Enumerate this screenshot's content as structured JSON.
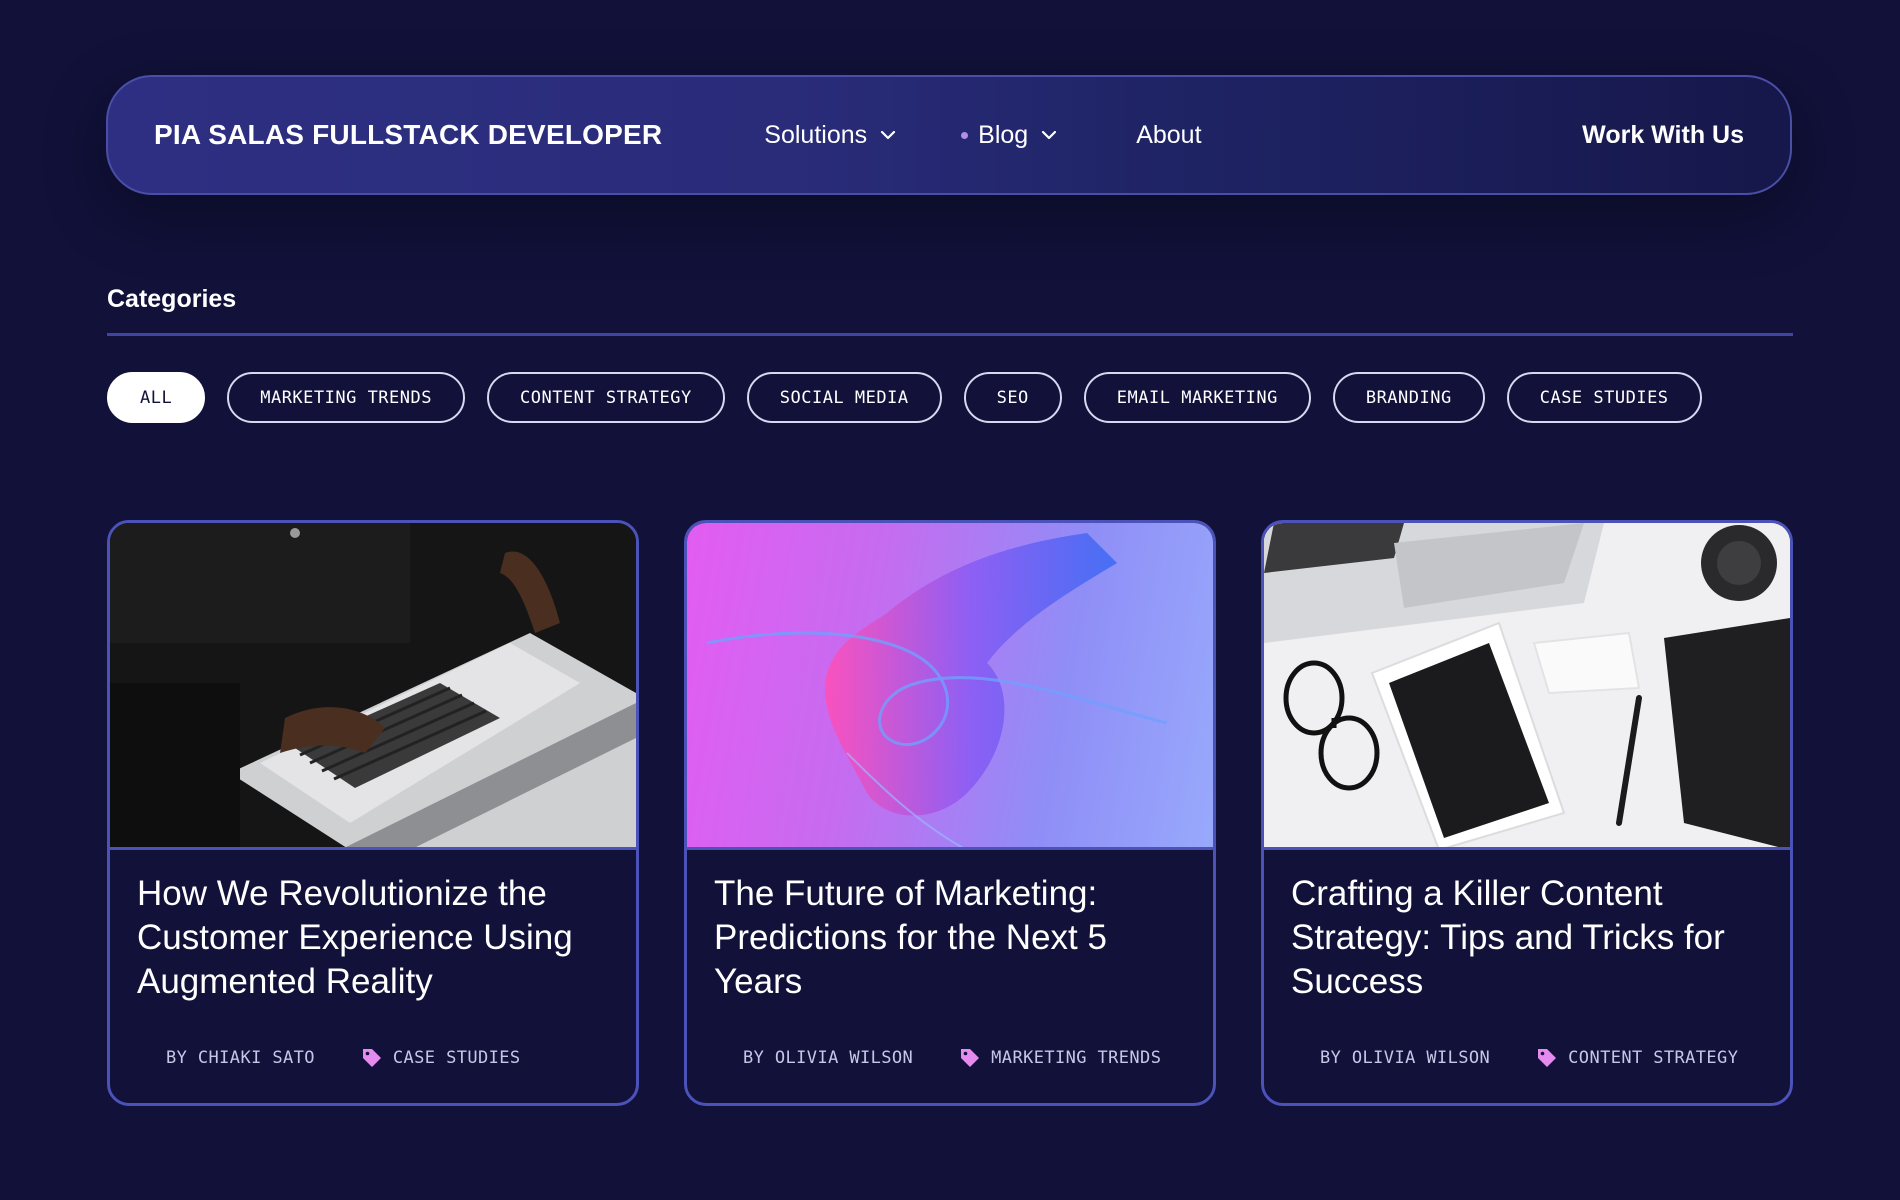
{
  "nav": {
    "brand": "PIA SALAS FULLSTACK DEVELOPER",
    "links": [
      {
        "label": "Solutions",
        "has_dropdown": true
      },
      {
        "label": "Blog",
        "has_dropdown": true,
        "active_dot": true
      },
      {
        "label": "About",
        "has_dropdown": false
      }
    ],
    "cta": "Work With Us"
  },
  "categories": {
    "title": "Categories",
    "chips": [
      {
        "label": "ALL",
        "active": true
      },
      {
        "label": "MARKETING TRENDS"
      },
      {
        "label": "CONTENT STRATEGY"
      },
      {
        "label": "SOCIAL MEDIA"
      },
      {
        "label": "SEO"
      },
      {
        "label": "EMAIL MARKETING"
      },
      {
        "label": "BRANDING"
      },
      {
        "label": "CASE STUDIES"
      }
    ]
  },
  "posts": [
    {
      "title": "How We Revolutionize the Customer Experience Using Augmented Reality",
      "author": "BY CHIAKI SATO",
      "category": "CASE STUDIES",
      "image": "laptop-typing-photo"
    },
    {
      "title": "The Future of Marketing: Predictions for the Next 5 Years",
      "author": "BY OLIVIA WILSON",
      "category": "MARKETING TRENDS",
      "image": "neon-hand-photo"
    },
    {
      "title": "Crafting a Killer Content Strategy: Tips and Tricks for Success",
      "author": "BY OLIVIA WILSON",
      "category": "CONTENT STRATEGY",
      "image": "desk-flatlay-photo"
    }
  ],
  "colors": {
    "background": "#11113a",
    "nav_gradient_start": "#2e2f82",
    "border": "#4b52b8",
    "tag_icon": "#e58bf0"
  }
}
